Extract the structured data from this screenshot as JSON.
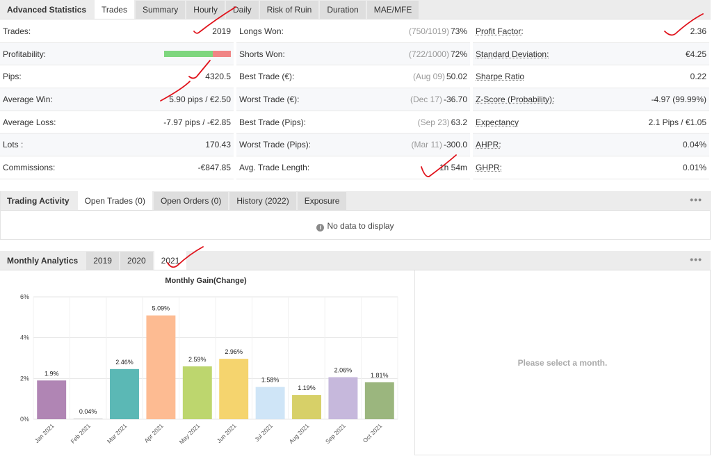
{
  "top_tabs": [
    "Advanced Statistics",
    "Trades",
    "Summary",
    "Hourly",
    "Daily",
    "Risk of Ruin",
    "Duration",
    "MAE/MFE"
  ],
  "stats": {
    "col1": [
      {
        "label": "Trades:",
        "value": "2019"
      },
      {
        "label": "Profitability:",
        "value": "",
        "bar": {
          "win_fraction": 0.73
        }
      },
      {
        "label": "Pips:",
        "value": "4320.5"
      },
      {
        "label": "Average Win:",
        "value": "5.90 pips / €2.50"
      },
      {
        "label": "Average Loss:",
        "value": "-7.97 pips / -€2.85"
      },
      {
        "label": "Lots :",
        "value": "170.43"
      },
      {
        "label": "Commissions:",
        "value": "-€847.85"
      }
    ],
    "col2": [
      {
        "label": "Longs Won:",
        "muted": "(750/1019)",
        "value": "73%"
      },
      {
        "label": "Shorts Won:",
        "muted": "(722/1000)",
        "value": "72%"
      },
      {
        "label": "Best Trade (€):",
        "muted": "(Aug 09)",
        "value": "50.02"
      },
      {
        "label": "Worst Trade (€):",
        "muted": "(Dec 17)",
        "value": "-36.70"
      },
      {
        "label": "Best Trade (Pips):",
        "muted": "(Sep 23)",
        "value": "63.2"
      },
      {
        "label": "Worst Trade (Pips):",
        "muted": "(Mar 11)",
        "value": "-300.0"
      },
      {
        "label": "Avg. Trade Length:",
        "muted": "",
        "value": "1h 54m"
      }
    ],
    "col3": [
      {
        "label": "Profit Factor:",
        "value": "2.36"
      },
      {
        "label": "Standard Deviation:",
        "value": "€4.25"
      },
      {
        "label": "Sharpe Ratio",
        "value": "0.22"
      },
      {
        "label": "Z-Score (Probability):",
        "value": "-4.97 (99.99%)"
      },
      {
        "label": "Expectancy",
        "value": "2.1 Pips / €1.05"
      },
      {
        "label": "AHPR:",
        "value": "0.04%"
      },
      {
        "label": "GHPR:",
        "value": "0.01%"
      }
    ]
  },
  "activity_tabs": [
    "Trading Activity",
    "Open Trades (0)",
    "Open Orders (0)",
    "History (2022)",
    "Exposure"
  ],
  "no_data": "No data to display",
  "monthly_tabs": [
    "Monthly Analytics",
    "2019",
    "2020",
    "2021"
  ],
  "more_label": "•••",
  "select_month": "Please select a month.",
  "colors": {
    "win": "#7ed67e",
    "loss": "#f08585",
    "annotation": "#e0121b"
  },
  "chart_data": {
    "type": "bar",
    "title": "Monthly Gain(Change)",
    "categories": [
      "Jan 2021",
      "Feb 2021",
      "Mar 2021",
      "Apr 2021",
      "May 2021",
      "Jun 2021",
      "Jul 2021",
      "Aug 2021",
      "Sep 2021",
      "Oct 2021"
    ],
    "values": [
      1.9,
      0.04,
      2.46,
      5.09,
      2.59,
      2.96,
      1.58,
      1.19,
      2.06,
      1.81
    ],
    "labels": [
      "1.9%",
      "0.04%",
      "2.46%",
      "5.09%",
      "2.59%",
      "2.96%",
      "1.58%",
      "1.19%",
      "2.06%",
      "1.81%"
    ],
    "colors": [
      "#b085b4",
      "#d8d8d8",
      "#5bb8b5",
      "#fdbb92",
      "#bdd66e",
      "#f5d46e",
      "#cfe5f7",
      "#d7d068",
      "#c6b8dc",
      "#9bb67e"
    ],
    "yticks": [
      0,
      2,
      4,
      6
    ],
    "ytick_labels": [
      "0%",
      "2%",
      "4%",
      "6%"
    ],
    "ylim": [
      0,
      6
    ],
    "grid": true
  }
}
